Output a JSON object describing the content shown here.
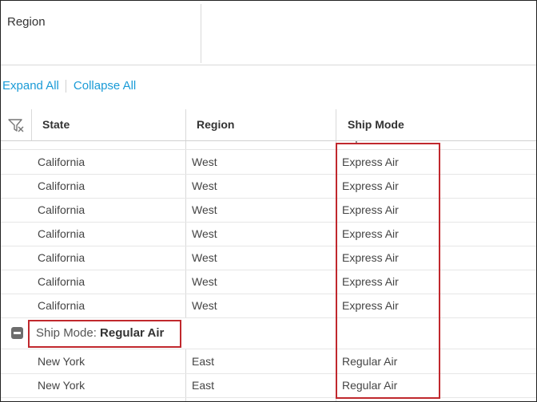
{
  "group_panel": {
    "field_label": "Region"
  },
  "toolbar": {
    "expand_all": "Expand All",
    "collapse_all": "Collapse All"
  },
  "columns": {
    "state": "State",
    "region": "Region",
    "ship_mode": "Ship Mode"
  },
  "partial_row": {
    "state": "California",
    "region": "West",
    "ship_mode": "Express Air"
  },
  "rows_group1": [
    {
      "state": "California",
      "region": "West",
      "ship_mode": "Express Air"
    },
    {
      "state": "California",
      "region": "West",
      "ship_mode": "Express Air"
    },
    {
      "state": "California",
      "region": "West",
      "ship_mode": "Express Air"
    },
    {
      "state": "California",
      "region": "West",
      "ship_mode": "Express Air"
    },
    {
      "state": "California",
      "region": "West",
      "ship_mode": "Express Air"
    },
    {
      "state": "California",
      "region": "West",
      "ship_mode": "Express Air"
    },
    {
      "state": "California",
      "region": "West",
      "ship_mode": "Express Air"
    }
  ],
  "group_header": {
    "prefix": "Ship Mode: ",
    "value": "Regular Air"
  },
  "rows_group2": [
    {
      "state": "New York",
      "region": "East",
      "ship_mode": "Regular Air"
    },
    {
      "state": "New York",
      "region": "East",
      "ship_mode": "Regular Air"
    }
  ],
  "colors": {
    "link": "#1a9bd7",
    "highlight": "#c0282d"
  }
}
